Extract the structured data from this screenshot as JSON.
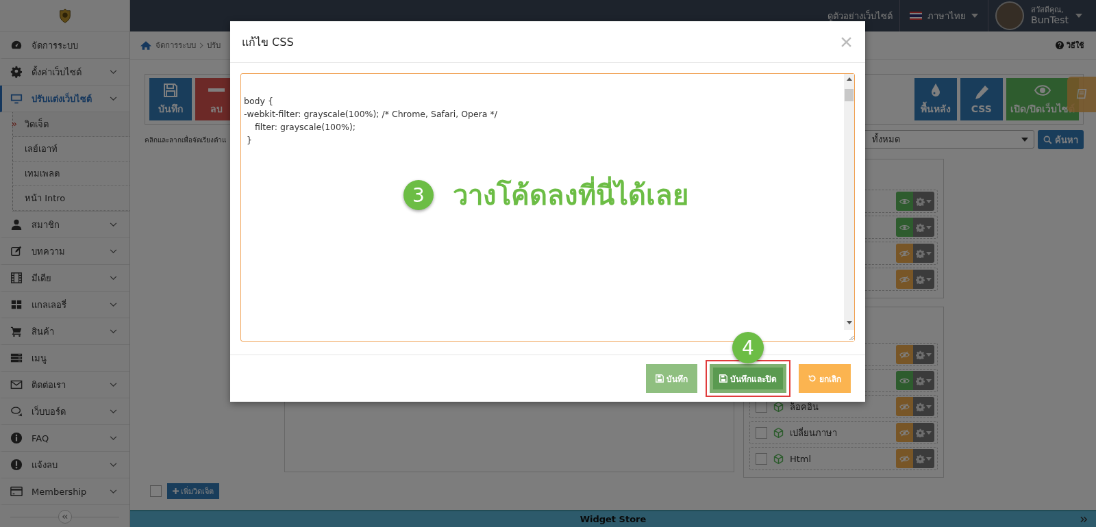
{
  "top_bar": {
    "preview_link": "ดูตัวอย่างเว็บไซต์",
    "language": "ภาษาไทย",
    "greeting": "สวัสดีคุณ,",
    "username": "BunTest"
  },
  "sidebar": {
    "items": [
      {
        "label": "จัดการระบบ",
        "expandable": false,
        "selected": false
      },
      {
        "label": "ตั้งค่าเว็บไซต์",
        "expandable": true,
        "selected": false
      },
      {
        "label": "ปรับแต่งเว็บไซต์",
        "expandable": true,
        "selected": true,
        "children": [
          {
            "label": "วิดเจ็ต",
            "selected": true
          },
          {
            "label": "เลย์เอาท์",
            "selected": false
          },
          {
            "label": "เทมเพลต",
            "selected": false
          },
          {
            "label": "หน้า Intro",
            "selected": false
          }
        ]
      },
      {
        "label": "สมาชิก",
        "expandable": true,
        "selected": false
      },
      {
        "label": "บทความ",
        "expandable": true,
        "selected": false
      },
      {
        "label": "มีเดีย",
        "expandable": true,
        "selected": false
      },
      {
        "label": "แกลเลอรี่",
        "expandable": true,
        "selected": false
      },
      {
        "label": "สินค้า",
        "expandable": true,
        "selected": false
      },
      {
        "label": "เมนู",
        "expandable": false,
        "selected": false
      },
      {
        "label": "ติดต่อเรา",
        "expandable": true,
        "selected": false
      },
      {
        "label": "เว็บบอร์ด",
        "expandable": true,
        "selected": false
      },
      {
        "label": "FAQ",
        "expandable": true,
        "selected": false
      },
      {
        "label": "แจ้งลบ",
        "expandable": true,
        "selected": false
      },
      {
        "label": "Membership",
        "expandable": true,
        "selected": false
      }
    ]
  },
  "breadcrumb": [
    "จัดการระบบ",
    "ปรับ"
  ],
  "help_link": "วิธีใช้",
  "toolbar": {
    "left_buttons": [
      {
        "label": "บันทึก",
        "kind": "save"
      },
      {
        "label": "ลบ",
        "kind": "delete"
      }
    ],
    "right_buttons": [
      {
        "label": "พื้นหลัง",
        "kind": "background"
      },
      {
        "label": "CSS",
        "kind": "css"
      },
      {
        "label": "เปิด/ปิดเว็บไซต์",
        "kind": "toggle"
      }
    ]
  },
  "hint": "คลิกและลากเพื่อจัดเรียงตำแ",
  "filter": {
    "value": "ทั้งหมด",
    "search_button": "ค้นหา"
  },
  "widget_groups": [
    {
      "widgets": [
        {
          "visible": true
        },
        {
          "visible": true
        },
        {
          "visible": false
        },
        {
          "visible": false
        }
      ]
    },
    {
      "widgets": [
        {
          "visible": false
        },
        {
          "visible": true
        },
        {
          "label": "ล็อคอิน",
          "checked": false,
          "visible": false
        },
        {
          "label": "เปลี่ยนภาษา",
          "checked": false,
          "visible": false
        },
        {
          "label": "Html",
          "checked": false,
          "visible": false
        }
      ]
    }
  ],
  "add_widget": {
    "checked": false,
    "button": "เพิ่มวิดเจ็ต"
  },
  "widget_store": "Widget Store",
  "dialog": {
    "title": "แก้ไข CSS",
    "css_code": "body {\n-webkit-filter: grayscale(100%); /* Chrome, Safari, Opera */\n    filter: grayscale(100%);\n }",
    "annotation_step": "3",
    "annotation_text": "วางโค้ดลงที่นี่ได้เลย",
    "button_step": "4",
    "buttons": [
      {
        "label": "บันทึก",
        "kind": "save",
        "highlighted": false
      },
      {
        "label": "บันทึกและปิด",
        "kind": "save_close",
        "highlighted": true
      },
      {
        "label": "ยกเลิก",
        "kind": "cancel",
        "highlighted": false
      }
    ]
  }
}
